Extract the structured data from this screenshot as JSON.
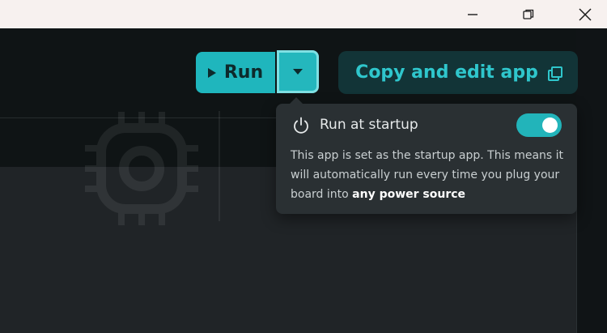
{
  "window": {
    "controls": [
      "minimize-icon",
      "maximize-icon",
      "close-icon"
    ]
  },
  "toolbar": {
    "run_label": "Run",
    "copy_label": "Copy and edit app"
  },
  "popover": {
    "title": "Run at startup",
    "toggle_on": true,
    "description_prefix": "This app is set as the startup app. This means it will automatically run every time you plug your board into ",
    "description_bold": "any power source"
  },
  "colors": {
    "accent": "#1fb6bd",
    "copy_button_bg": "#123437",
    "popover_bg": "#2a3033"
  }
}
